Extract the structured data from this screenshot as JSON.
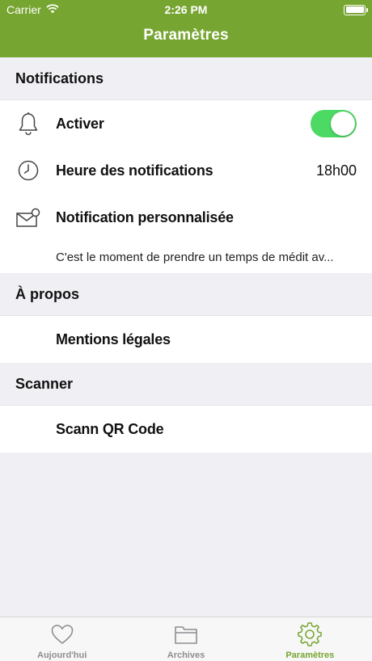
{
  "status_bar": {
    "carrier": "Carrier",
    "time": "2:26 PM"
  },
  "nav": {
    "title": "Paramètres"
  },
  "sections": {
    "notifications": {
      "title": "Notifications",
      "enable_label": "Activer",
      "enable_on": true,
      "time_label": "Heure des notifications",
      "time_value": "18h00",
      "custom_label": "Notification personnalisée",
      "custom_text": "C'est le moment de prendre un temps de médit av..."
    },
    "about": {
      "title": "À propos",
      "legal_label": "Mentions légales"
    },
    "scanner": {
      "title": "Scanner",
      "qr_label": "Scann QR Code"
    }
  },
  "tabs": [
    {
      "label": "Aujourd'hui",
      "icon": "heart-icon"
    },
    {
      "label": "Archives",
      "icon": "folder-icon"
    },
    {
      "label": "Paramètres",
      "icon": "gear-icon"
    }
  ],
  "colors": {
    "brand": "#77a531",
    "toggle_on": "#4cd964",
    "inactive": "#8e8e93"
  }
}
